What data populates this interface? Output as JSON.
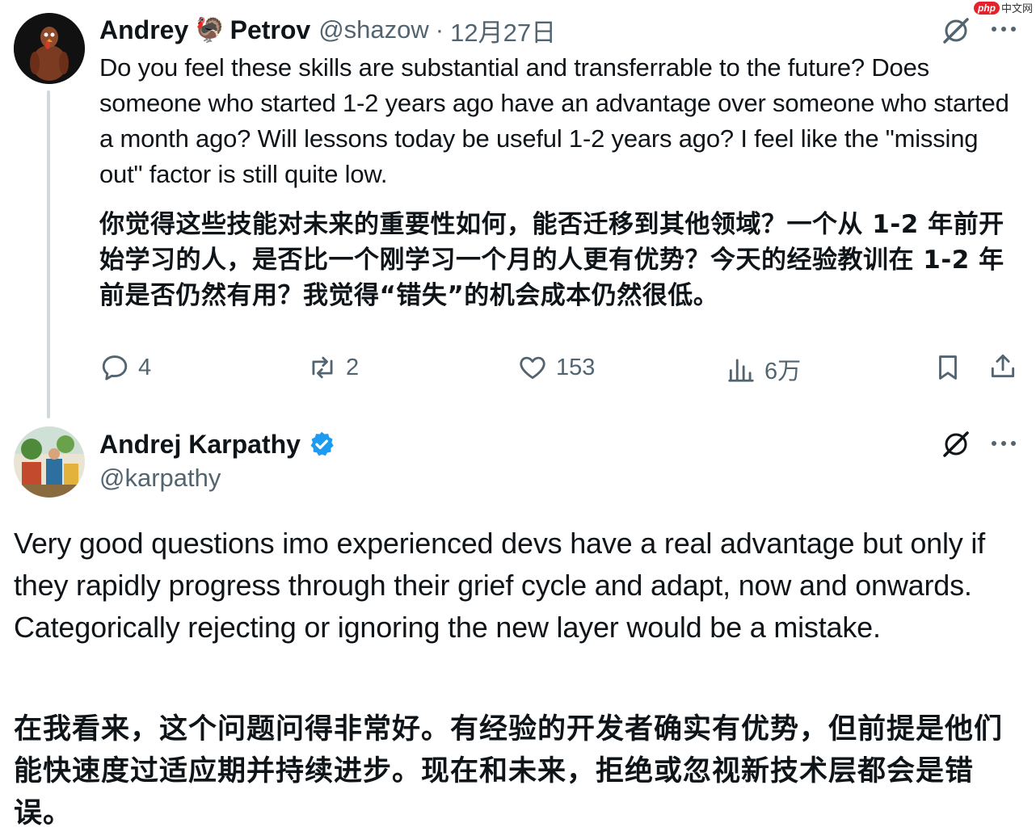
{
  "watermark": {
    "badge": "php",
    "text": "中文网"
  },
  "reply_tweet": {
    "author_first": "Andrey",
    "author_emoji": "🦃",
    "author_last": "Petrov",
    "handle": "@shazow",
    "separator": "·",
    "date": "12月27日",
    "text_en": "Do you feel these skills are substantial and transferrable to the future? Does someone who started 1-2 years ago have an advantage over someone who started a month ago? Will lessons today be useful 1-2 years ago? I feel like the \"missing out\" factor is still quite low.",
    "text_cn": "你觉得这些技能对未来的重要性如何，能否迁移到其他领域？一个从 1-2 年前开始学习的人，是否比一个刚学习一个月的人更有优势？今天的经验教训在 1-2 年前是否仍然有用？我觉得“错失”的机会成本仍然很低。",
    "actions": {
      "replies": "4",
      "reposts": "2",
      "likes": "153",
      "views": "6万"
    }
  },
  "main_tweet": {
    "author": "Andrej Karpathy",
    "handle": "@karpathy",
    "verified": true,
    "text_en": "Very good questions imo experienced devs have a real advantage but only if they rapidly progress through their grief cycle and adapt, now and onwards. Categorically rejecting or ignoring the new layer would be a mistake.",
    "text_cn": "在我看来，这个问题问得非常好。有经验的开发者确实有优势，但前提是他们能快速度过适应期并持续进步。现在和未来，拒绝或忽视新技术层都会是错误。"
  },
  "colors": {
    "text": "#0f1419",
    "muted": "#536471",
    "thread_line": "#cfd9de",
    "verified": "#1d9bf0",
    "watermark_red": "#e3232b"
  }
}
